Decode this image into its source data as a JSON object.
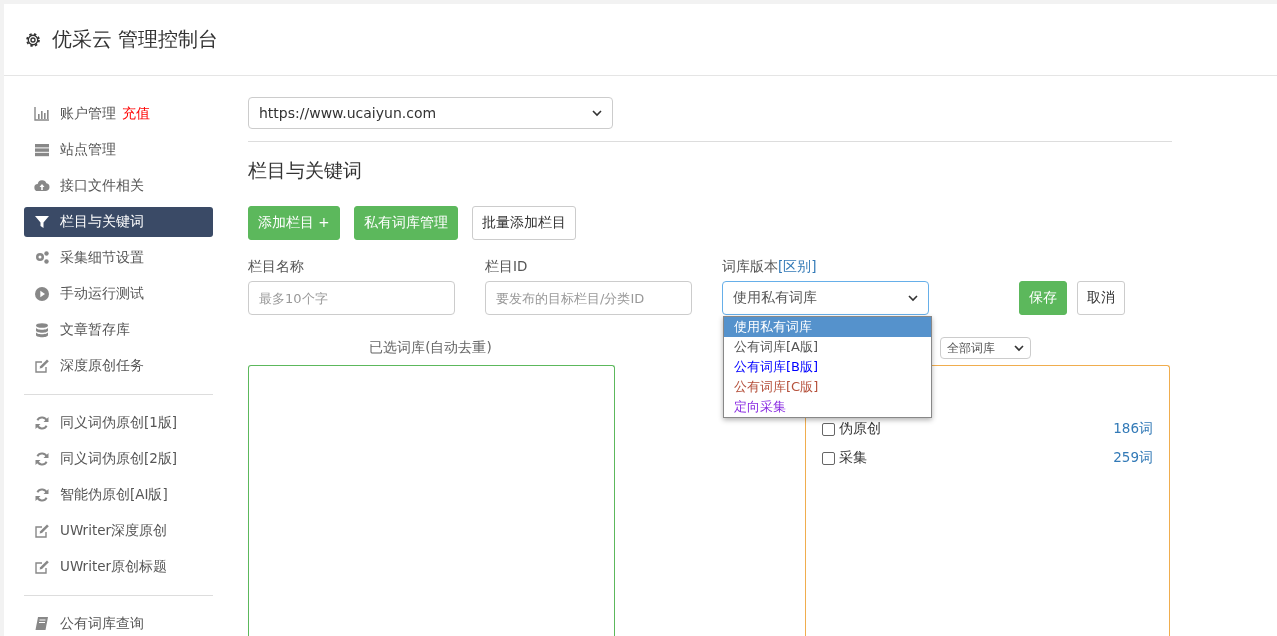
{
  "header": {
    "title": "优采云 管理控制台"
  },
  "sidebar": {
    "groups": [
      [
        {
          "label": "账户管理",
          "badge": "充值",
          "selected": false
        },
        {
          "label": "站点管理",
          "selected": false
        },
        {
          "label": "接口文件相关",
          "selected": false
        },
        {
          "label": "栏目与关键词",
          "selected": true
        },
        {
          "label": "采集细节设置",
          "selected": false
        },
        {
          "label": "手动运行测试",
          "selected": false
        },
        {
          "label": "文章暂存库",
          "selected": false
        },
        {
          "label": "深度原创任务",
          "selected": false
        }
      ],
      [
        {
          "label": "同义词伪原创[1版]",
          "selected": false
        },
        {
          "label": "同义词伪原创[2版]",
          "selected": false
        },
        {
          "label": "智能伪原创[AI版]",
          "selected": false
        },
        {
          "label": "UWriter深度原创",
          "selected": false
        },
        {
          "label": "UWriter原创标题",
          "selected": false
        }
      ],
      [
        {
          "label": "公有词库查询",
          "selected": false
        }
      ]
    ]
  },
  "site_select": {
    "value": "https://www.ucaiyun.com"
  },
  "section_title": "栏目与关键词",
  "actions": [
    {
      "label": "添加栏目 +",
      "kind": "primary"
    },
    {
      "label": "私有词库管理",
      "kind": "primary"
    },
    {
      "label": "批量添加栏目",
      "kind": "default"
    }
  ],
  "form": {
    "name": {
      "label": "栏目名称",
      "placeholder": "最多10个字"
    },
    "id": {
      "label": "栏目ID",
      "placeholder": "要发布的目标栏目/分类ID"
    },
    "version": {
      "label": "词库版本",
      "link": "[区别]",
      "value": "使用私有词库",
      "options": [
        {
          "label": "使用私有词库",
          "selected": true
        },
        {
          "label": "公有词库[A版]",
          "selected": false,
          "color": "#555555"
        },
        {
          "label": "公有词库[B版]",
          "selected": false,
          "color": "#0000ff"
        },
        {
          "label": "公有词库[C版]",
          "selected": false,
          "color": "#b5513b"
        },
        {
          "label": "定向采集",
          "selected": false,
          "color": "#8a2be2"
        }
      ]
    },
    "save": "保存",
    "cancel": "取消"
  },
  "selected_libs": {
    "title": "已选词库(自动去重)"
  },
  "lib_filter": {
    "value": "全部词库"
  },
  "libraries": [
    {
      "name": "伪原创",
      "count": "186词",
      "checked": false
    },
    {
      "name": "采集",
      "count": "259词",
      "checked": false
    }
  ]
}
